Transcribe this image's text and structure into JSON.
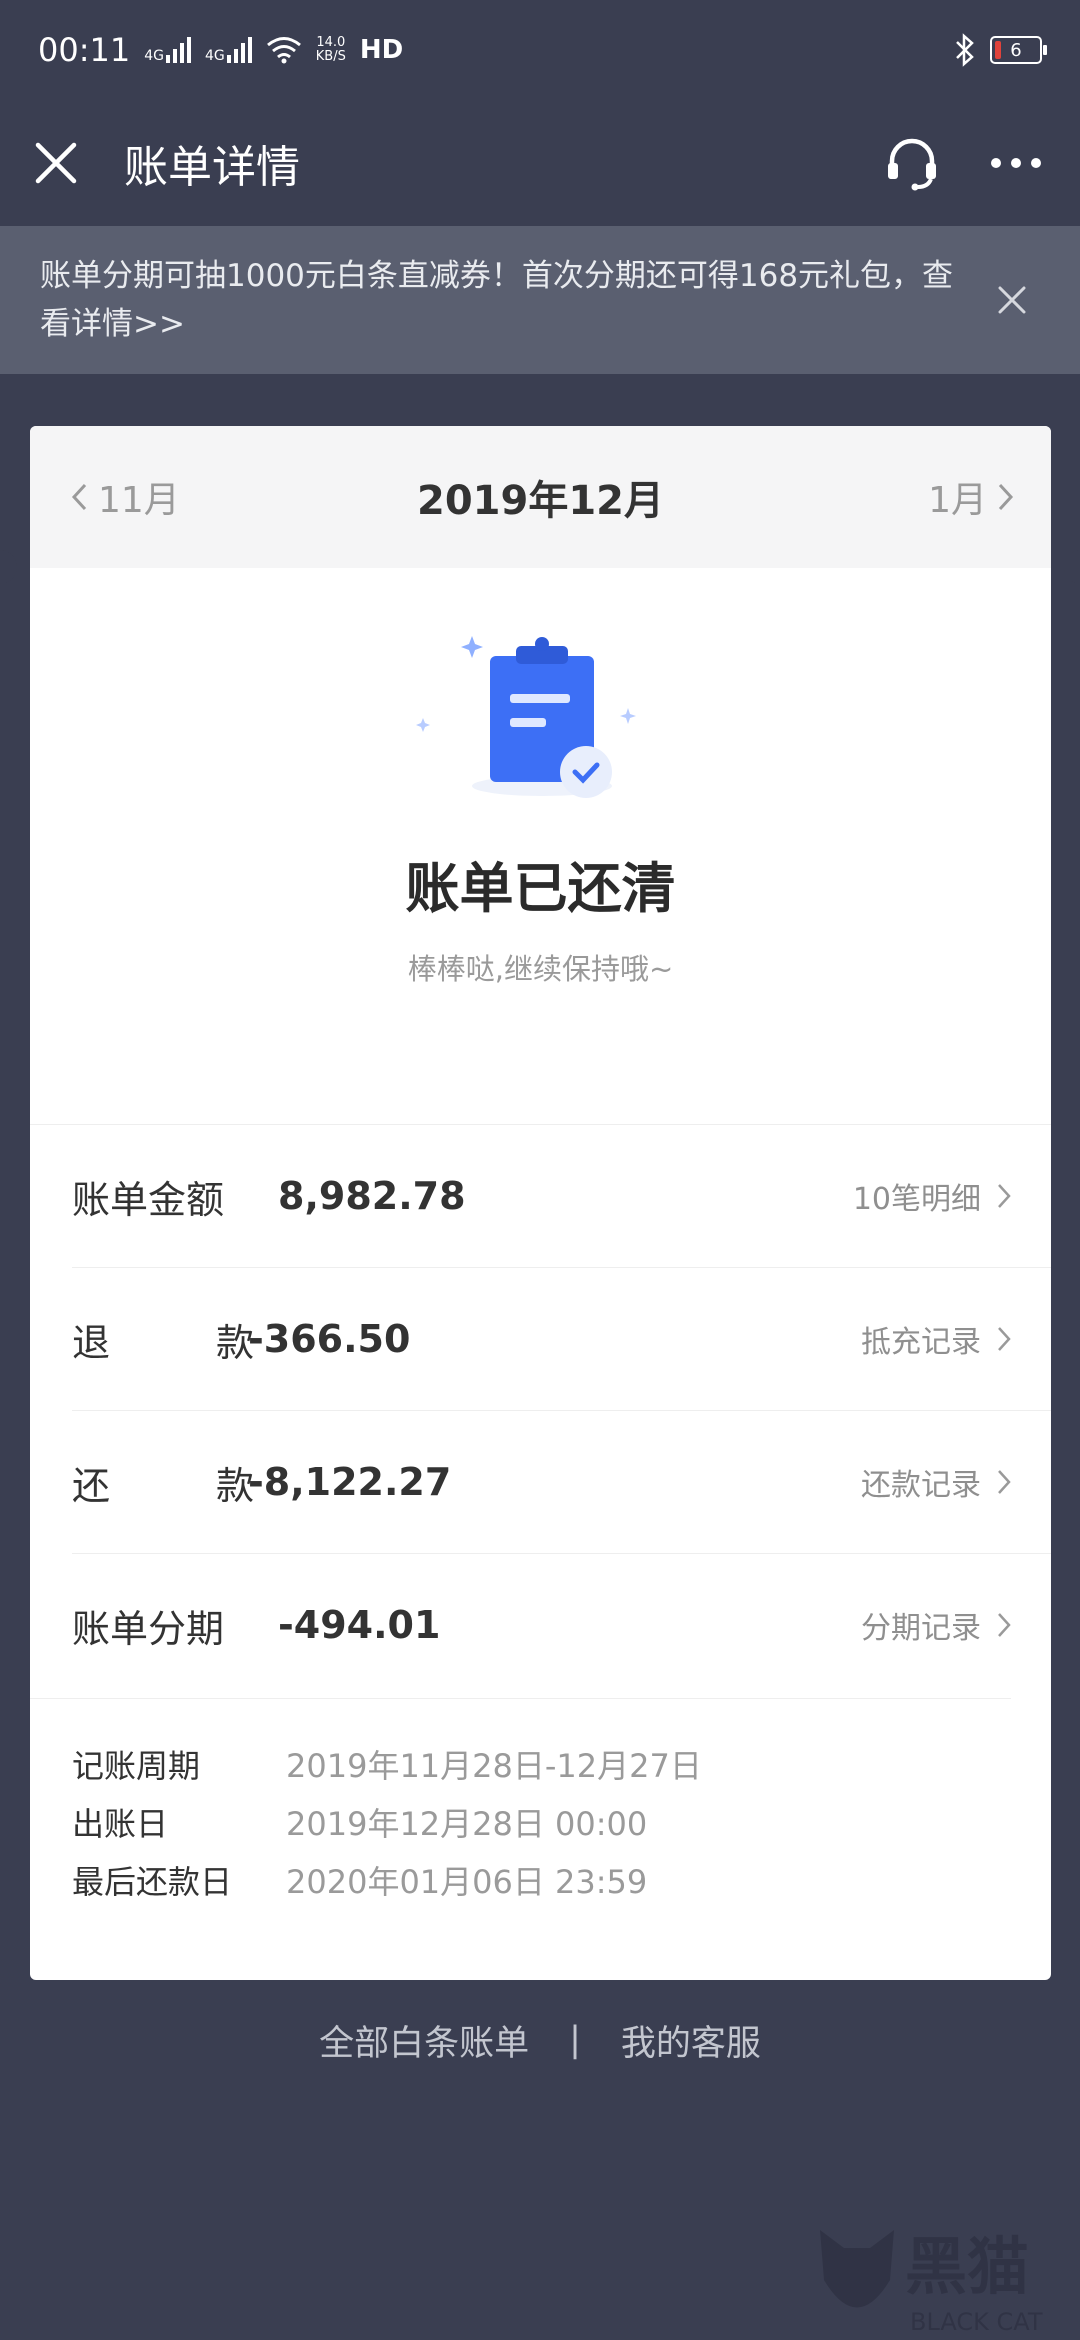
{
  "status_bar": {
    "time": "00:11",
    "net1": "4G",
    "net2": "4G",
    "speed_top": "14.0",
    "speed_bottom": "KB/S",
    "hd": "HD",
    "battery": "6"
  },
  "header": {
    "title": "账单详情"
  },
  "banner": {
    "text": "账单分期可抽1000元白条直减券！首次分期还可得168元礼包，查看详情>>"
  },
  "month_nav": {
    "prev": "11月",
    "current": "2019年12月",
    "next": "1月"
  },
  "status": {
    "title": "账单已还清",
    "subtitle": "棒棒哒,继续保持哦~"
  },
  "rows": [
    {
      "label": "账单金额",
      "amount": "8,982.78",
      "link": "10笔明细"
    },
    {
      "label_a": "退",
      "label_b": "款",
      "amount": "-366.50",
      "link": "抵充记录"
    },
    {
      "label_a": "还",
      "label_b": "款",
      "amount": "-8,122.27",
      "link": "还款记录"
    },
    {
      "label": "账单分期",
      "amount": "-494.01",
      "link": "分期记录"
    }
  ],
  "info": [
    {
      "key": "记账周期",
      "value": "2019年11月28日-12月27日"
    },
    {
      "key": "出账日",
      "value": "2019年12月28日 00:00"
    },
    {
      "key": "最后还款日",
      "value": "2020年01月06日 23:59"
    }
  ],
  "footer": {
    "all_bills": "全部白条账单",
    "separator": "|",
    "service": "我的客服"
  },
  "colors": {
    "background": "#3a3e51",
    "banner": "#5a5f70",
    "accent": "#3d6ff5"
  },
  "watermark": {
    "text": "黑猫",
    "sub": "BLACK CAT"
  }
}
